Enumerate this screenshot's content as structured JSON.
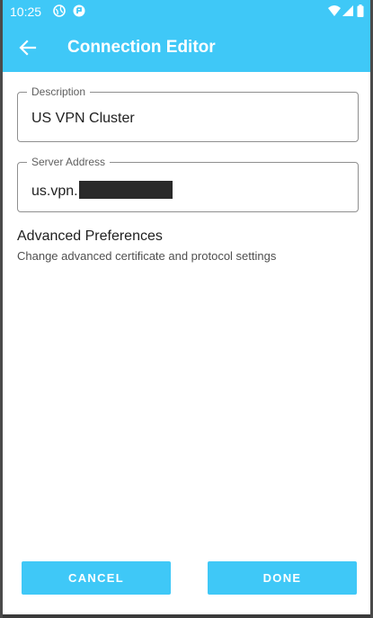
{
  "status_bar": {
    "time": "10:25",
    "left_icons": [
      "globe-icon",
      "app-notification-icon"
    ],
    "right_icons": [
      "wifi-icon",
      "signal-icon",
      "battery-icon"
    ]
  },
  "app_bar": {
    "title": "Connection Editor",
    "back_icon": "arrow-left-icon"
  },
  "form": {
    "description": {
      "label": "Description",
      "value": "US VPN Cluster"
    },
    "server_address": {
      "label": "Server Address",
      "value": "us.vpn.",
      "redacted": true
    }
  },
  "advanced": {
    "title": "Advanced Preferences",
    "subtitle": "Change advanced certificate and protocol settings"
  },
  "buttons": {
    "cancel": "CANCEL",
    "done": "DONE"
  },
  "colors": {
    "accent": "#3fc8f7",
    "background": "#ffffff",
    "field_border": "#8f8f8f"
  }
}
